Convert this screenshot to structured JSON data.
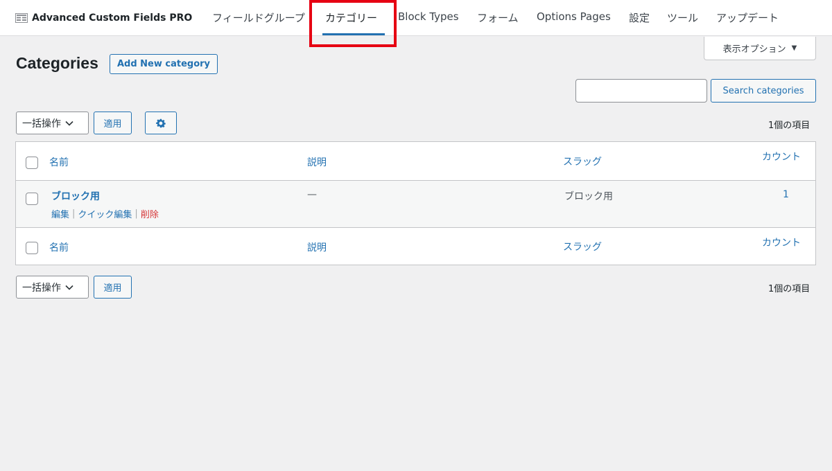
{
  "nav": {
    "brand": "Advanced Custom Fields PRO",
    "items": [
      {
        "label": "フィールドグループ"
      },
      {
        "label": "カテゴリー"
      },
      {
        "label": "Block Types"
      },
      {
        "label": "フォーム"
      },
      {
        "label": "Options Pages"
      },
      {
        "label": "設定"
      },
      {
        "label": "ツール"
      },
      {
        "label": "アップデート"
      }
    ],
    "active_index": 1
  },
  "screen_options": {
    "label": "表示オプション",
    "caret": "▼"
  },
  "page": {
    "title": "Categories",
    "add_new_label": "Add New category"
  },
  "search": {
    "value": "",
    "button_label": "Search categories"
  },
  "bulk": {
    "label": "一括操作",
    "apply_label": "適用",
    "count_label": "1個の項目"
  },
  "table": {
    "columns": {
      "name": "名前",
      "description": "説明",
      "slug": "スラッグ",
      "count": "カウント"
    },
    "rows": [
      {
        "name": "ブロック用",
        "description": "—",
        "slug": "ブロック用",
        "count": "1",
        "actions": {
          "edit": "編集",
          "quick_edit": "クイック編集",
          "delete": "削除",
          "separator": "|"
        }
      }
    ]
  },
  "colors": {
    "accent": "#2271b1",
    "danger": "#d63638",
    "highlight": "#e60012",
    "background": "#f0f0f1"
  }
}
